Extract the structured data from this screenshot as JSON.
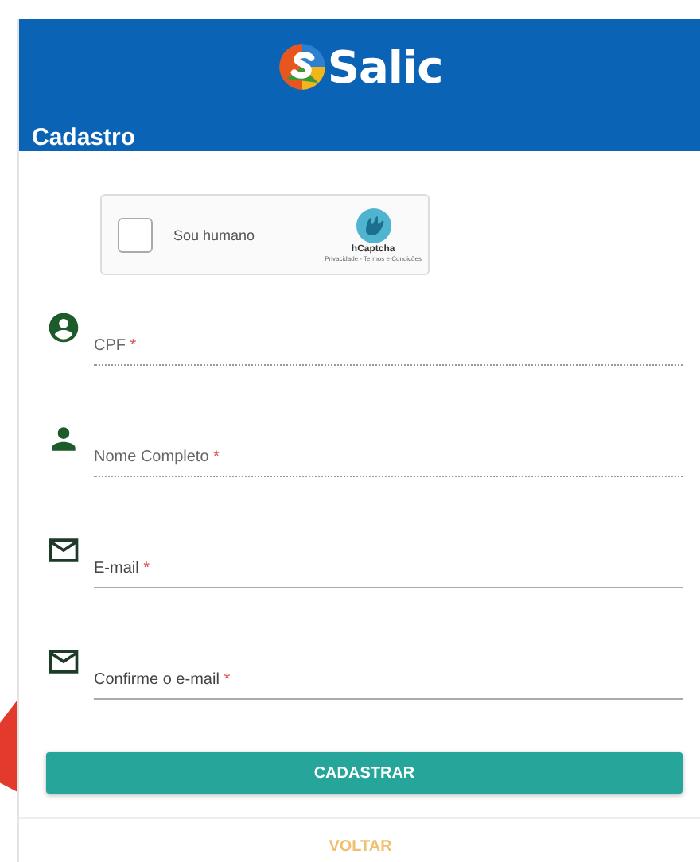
{
  "header": {
    "logo_text": "Salic",
    "title": "Cadastro"
  },
  "captcha": {
    "checked": false,
    "label": "Sou humano",
    "brand": "hCaptcha",
    "links": "Privacidade - Termos e Condições"
  },
  "fields": [
    {
      "kind": "id",
      "label": "CPF",
      "required_mark": "*",
      "disabled": true
    },
    {
      "kind": "name",
      "label": "Nome Completo",
      "required_mark": "*",
      "disabled": true
    },
    {
      "kind": "email",
      "label": "E-mail",
      "required_mark": "*",
      "disabled": false
    },
    {
      "kind": "email",
      "label": "Confirme o e-mail",
      "required_mark": "*",
      "disabled": false
    }
  ],
  "submit_button": "CADASTRAR",
  "back_link": "VOLTAR"
}
